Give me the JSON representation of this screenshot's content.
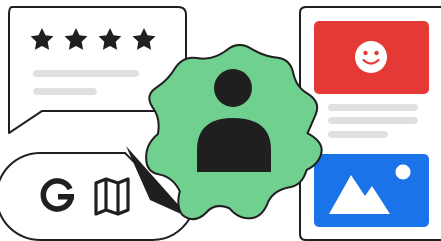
{
  "illustration": {
    "review_card": {
      "rating_stars": 4
    },
    "search_pill": {
      "icons": [
        "google-g-icon",
        "map-icon"
      ]
    },
    "profile_badge": {
      "icon": "person-icon",
      "fill_color": "#6fd08f"
    },
    "content_card": {
      "top_tile": {
        "icon": "smiley-icon",
        "color": "#e53935"
      },
      "bottom_tile": {
        "icon": "image-icon",
        "color": "#1a73e8"
      }
    },
    "colors": {
      "outline": "#1f1f1f",
      "placeholder_line": "#e0e0e0",
      "background": "#ffffff"
    }
  }
}
